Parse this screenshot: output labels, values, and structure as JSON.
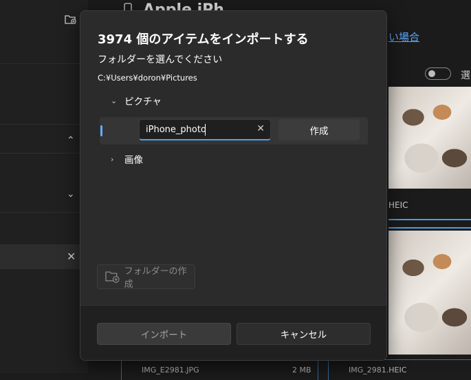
{
  "background": {
    "app_title": "Apple iPh",
    "link_text": "い場合",
    "toggle_label": "選",
    "photo_captions": [
      "HEIC"
    ],
    "bottom_cards": [
      "IMG_E2981.JPG",
      "2 MB",
      "IMG_2981.HEIC"
    ],
    "icons": [
      "add-folder-icon",
      "chevron-up-icon",
      "chevron-down-icon",
      "close-icon",
      "phone-icon"
    ]
  },
  "dialog": {
    "title": "3974 個のアイテムをインポートする",
    "subtitle": "フォルダーを選んでください",
    "path": "C:¥Users¥doron¥Pictures",
    "tree": {
      "pictures_label": "ピクチャ",
      "images_label": "画像"
    },
    "new_folder_input": {
      "value": "iPhone_photo",
      "clear_icon": "close-icon"
    },
    "create_button": "作成",
    "new_folder_button": "フォルダーの作成",
    "import_button": "インポート",
    "cancel_button": "キャンセル"
  },
  "colors": {
    "accent": "#4ca3f0",
    "dialog_bg": "#2b2b2b",
    "footer_bg": "#202020"
  }
}
